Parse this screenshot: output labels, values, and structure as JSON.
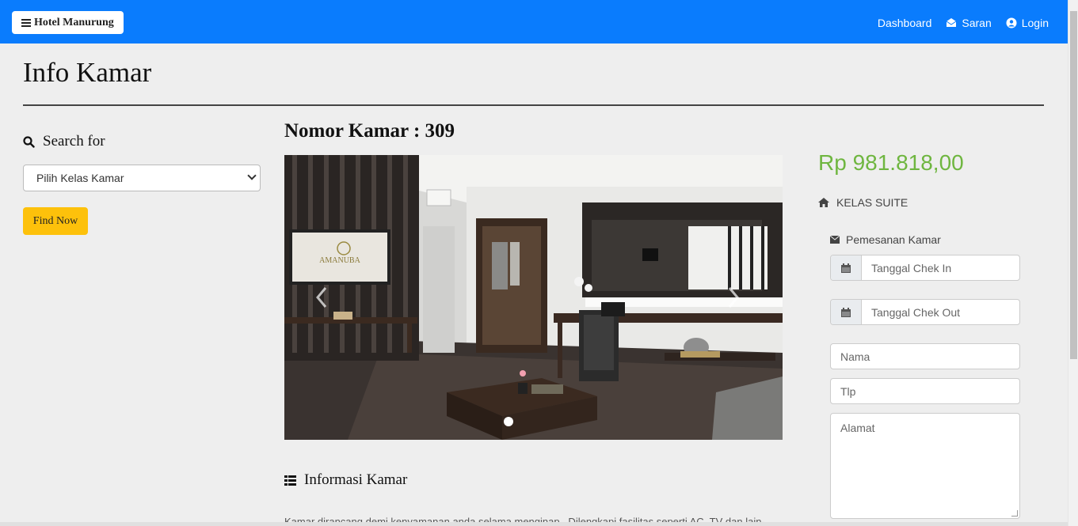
{
  "navbar": {
    "brand": "Hotel Manurung",
    "links": [
      {
        "label": "Dashboard",
        "icon": "none"
      },
      {
        "label": "Saran",
        "icon": "envelope-open-icon"
      },
      {
        "label": "Login",
        "icon": "user-circle-icon"
      }
    ]
  },
  "page": {
    "title": "Info Kamar"
  },
  "search": {
    "label": "Search for",
    "select_value": "Pilih Kelas Kamar",
    "button": "Find Now"
  },
  "room": {
    "title": "Nomor Kamar : 309",
    "price": "Rp 981.818,00",
    "class": "KELAS SUITE",
    "info_heading": "Informasi Kamar",
    "description": "Kamar dirancang demi kenyamanan anda selama menginap.. Dilengkapi fasilitas seperti AC, TV dan lain-",
    "photo_logo_text": "AMANUBA"
  },
  "booking": {
    "title": "Pemesanan Kamar",
    "checkin_placeholder": "Tanggal Chek In",
    "checkout_placeholder": "Tanggal Chek Out",
    "name_placeholder": "Nama",
    "phone_placeholder": "Tlp",
    "address_placeholder": "Alamat"
  },
  "colors": {
    "navbar": "#0a7cfd",
    "price": "#6fb640",
    "find_button": "#fdc10b",
    "background": "#eeeeee"
  }
}
